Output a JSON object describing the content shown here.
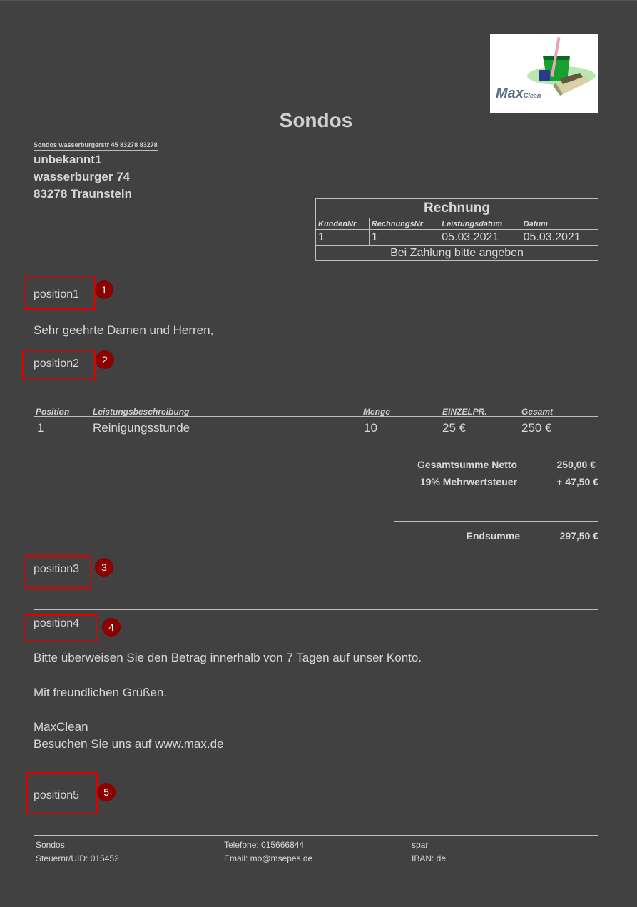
{
  "logo": {
    "text_large": "Max",
    "text_small": "Clean"
  },
  "title": "Sondos",
  "sender_line": "Sondos wasserburgerstr 45 83278 83278",
  "recipient": [
    "unbekannt1",
    "wasserburger 74",
    "83278 Traunstein"
  ],
  "invoice_box": {
    "heading": "Rechnung",
    "labels": [
      "KundenNr",
      "RechnungsNr",
      "Leistungsdatum",
      "Datum"
    ],
    "values": [
      "1",
      "1",
      "05.03.2021",
      "05.03.2021"
    ],
    "footer": "Bei Zahlung bitte angeben"
  },
  "markers": [
    {
      "text": "position1",
      "number": "1"
    },
    {
      "text": "position2",
      "number": "2"
    },
    {
      "text": "position3",
      "number": "3"
    },
    {
      "text": "position4",
      "number": "4"
    },
    {
      "text": "position5",
      "number": "5"
    }
  ],
  "greeting": "Sehr geehrte Damen und Herren,",
  "items_table": {
    "headers": [
      "Position",
      "Leistungsbeschreibung",
      "Menge",
      "EINZELPR.",
      "Gesamt"
    ],
    "rows": [
      [
        "1",
        "Reinigungsstunde",
        "10",
        "25 €",
        "250 €"
      ]
    ]
  },
  "totals": {
    "net_label": "Gesamtsumme Netto",
    "net_value": "250,00 €",
    "vat_label": "19% Mehrwertsteuer",
    "vat_value": "+ 47,50 €",
    "end_label": "Endsumme",
    "end_value": "297,50 €"
  },
  "payment_text": "Bitte überweisen Sie den Betrag innerhalb von 7 Tagen auf unser Konto.",
  "closing": "Mit freundlichen Grüßen.",
  "company": "MaxClean",
  "website_line": "Besuchen Sie uns auf www.max.de",
  "footer": {
    "col1": [
      "Sondos",
      "Steuernr/UID: 015452"
    ],
    "col2": [
      "Telefone: 015666844",
      "Email: mo@msepes.de"
    ],
    "col3": [
      "spar",
      "IBAN: de"
    ]
  }
}
